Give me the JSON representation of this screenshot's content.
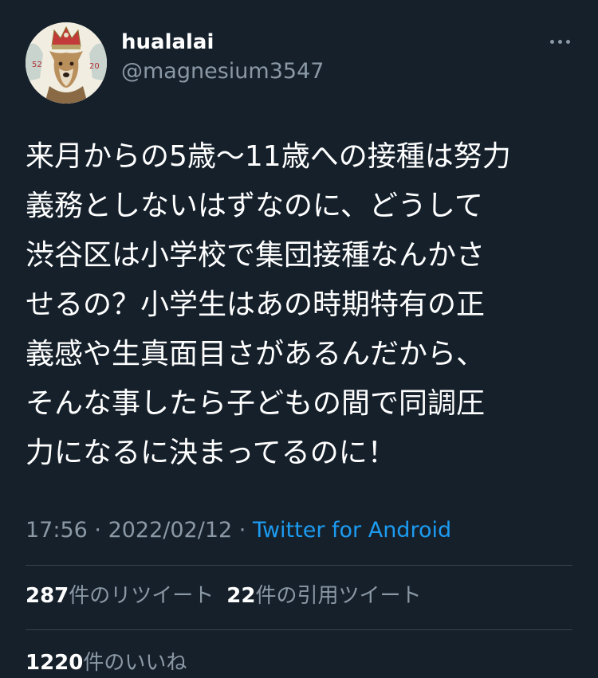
{
  "tweet": {
    "display_name": "hualalai",
    "handle": "@magnesium3547",
    "avatar": {
      "icon": "dog-with-crown-avatar",
      "badge_left": "52",
      "badge_right": "20"
    },
    "body_lines": [
      "来月からの5歳〜11歳への接種は努力",
      "義務としないはずなのに、どうして",
      "渋谷区は小学校で集団接種なんかさ",
      "せるの？小学生はあの時期特有の正",
      "義感や生真面目さがあるんだから、",
      "そんな事したら子どもの間で同調圧",
      "力になるに決まってるのに！"
    ],
    "time": "17:56",
    "separator": " · ",
    "date": "2022/02/12",
    "source": "Twitter for Android"
  },
  "stats": {
    "retweets": {
      "count": "287",
      "label": "件のリツイート"
    },
    "quotes": {
      "count": "22",
      "label": "件の引用ツイート"
    },
    "likes": {
      "count": "1220",
      "label": "件のいいね"
    }
  },
  "colors": {
    "background": "#15202b",
    "text": "#ffffff",
    "secondary": "#8b98a5",
    "link": "#1d9bf0",
    "divider": "#38444d"
  },
  "icons": {
    "more": "more-horizontal-icon"
  }
}
